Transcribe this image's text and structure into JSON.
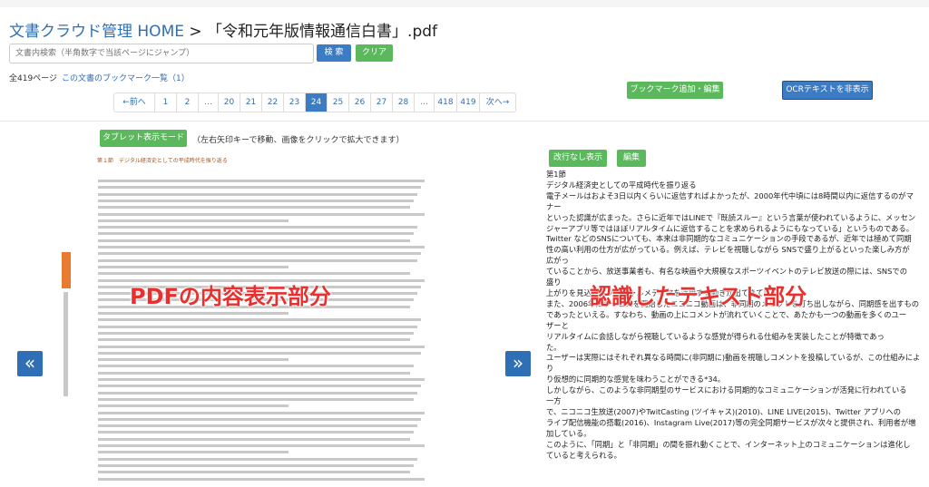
{
  "header": {
    "home_link": "文書クラウド管理 HOME",
    "separator": " > ",
    "document_title": "「令和元年版情報通信白書」.pdf"
  },
  "search": {
    "placeholder": "文書内検索（半角数字で当該ページにジャンプ）",
    "search_label": "検 索",
    "clear_label": "クリア"
  },
  "info": {
    "page_count": "全419ページ",
    "bookmark_list": "この文書のブックマーク一覧（1）"
  },
  "pagination": {
    "prev": "←前へ",
    "next": "次へ→",
    "items": [
      "1",
      "2",
      "...",
      "20",
      "21",
      "22",
      "23",
      "24",
      "25",
      "26",
      "27",
      "28",
      "...",
      "418",
      "419"
    ],
    "active": "24"
  },
  "actions": {
    "add_bookmark": "ブックマーク追加・編集",
    "hide_ocr": "OCRテキストを非表示"
  },
  "viewer": {
    "tablet_mode": "タブレット表示モード",
    "hint": "（左右矢印キーで移動、画像をクリックで拡大できます）",
    "prev_icon": "«",
    "next_icon": "»",
    "pdf_heading": "第１節　デジタル経済史としての平成時代を振り返る",
    "pdf_label": "PDFの内容表示部分",
    "ocr_label": "認識したテキスト部分"
  },
  "ocr": {
    "no_break_button": "改行なし表示",
    "edit_button": "編集",
    "lines": [
      "第1節",
      "デジタル経済史としての平成時代を振り返る",
      "電子メールはおよそ3日以内くらいに返信すればよかったが、2000年代中頃には8時間以内に返信するのがマ",
      "ナー",
      "といった認識が広まった。さらに近年ではLINEで『既読スルー』という言葉が使われているように、メッセン",
      "ジャーアプリ等ではほぼリアルタイムに返信することを求められるようにもなっている」というものである。",
      "Twitter などのSNSについても、本来は非同期的なコミュニケーションの手段であるが、近年では極めて同期",
      "性の高い利用の仕方が広がっている。例えば、テレビを視聴しながら SNSで盛り上がるといった楽しみ方が",
      "広がっ",
      "ていることから、放送事業者も、有名な映画や大規模なスポーツイベントのテレビ放送の際には、SNSでの",
      "盛り",
      "上がりを見込んだソーシャルメディアを活用する動きが出てきている。",
      "また、2006年にサービスを開始したニコニコ動画は、非同期のメリットを打ち出しながら、同期感を出すもの",
      "であったといえる。すなわち、動画の上にコメントが流れていくことで、あたかも一つの動画を多くのユー",
      "ザーと",
      "リアルタイムに会話しながら視聴しているような感覚が得られる仕組みを実装したことが特徴であっ",
      "た。",
      "ユーザーは実際にはそれぞれ異なる時間に(非同期に)動画を視聴しコメントを投稿しているが、この仕組みによ",
      "り",
      "り仮想的に同期的な感覚を味わうことができる*34。",
      "しかしながら、このような非同期型のサービスにおける同期的なコミュニケーションが活発に行われている",
      "一方",
      "で、ニコニコ生放送(2007)やTwitCasting (ツイキャス)(2010)、LINE LIVE(2015)、Twitter アプリへの",
      "ライブ配信機能の搭載(2016)、Instagram Live(2017)等の完全同期サービスが次々と提供され、利用者が増",
      "加している。",
      "このように、「同期」と「非同期」の間を振れ動くことで、インターネット上のコミュニケーションは進化し",
      "ていると考えられる。"
    ]
  },
  "colors": {
    "link": "#2f6fb5",
    "primary_button": "#3b7cc4",
    "success_button": "#5cb85c",
    "annotation_red": "#e8312f"
  }
}
